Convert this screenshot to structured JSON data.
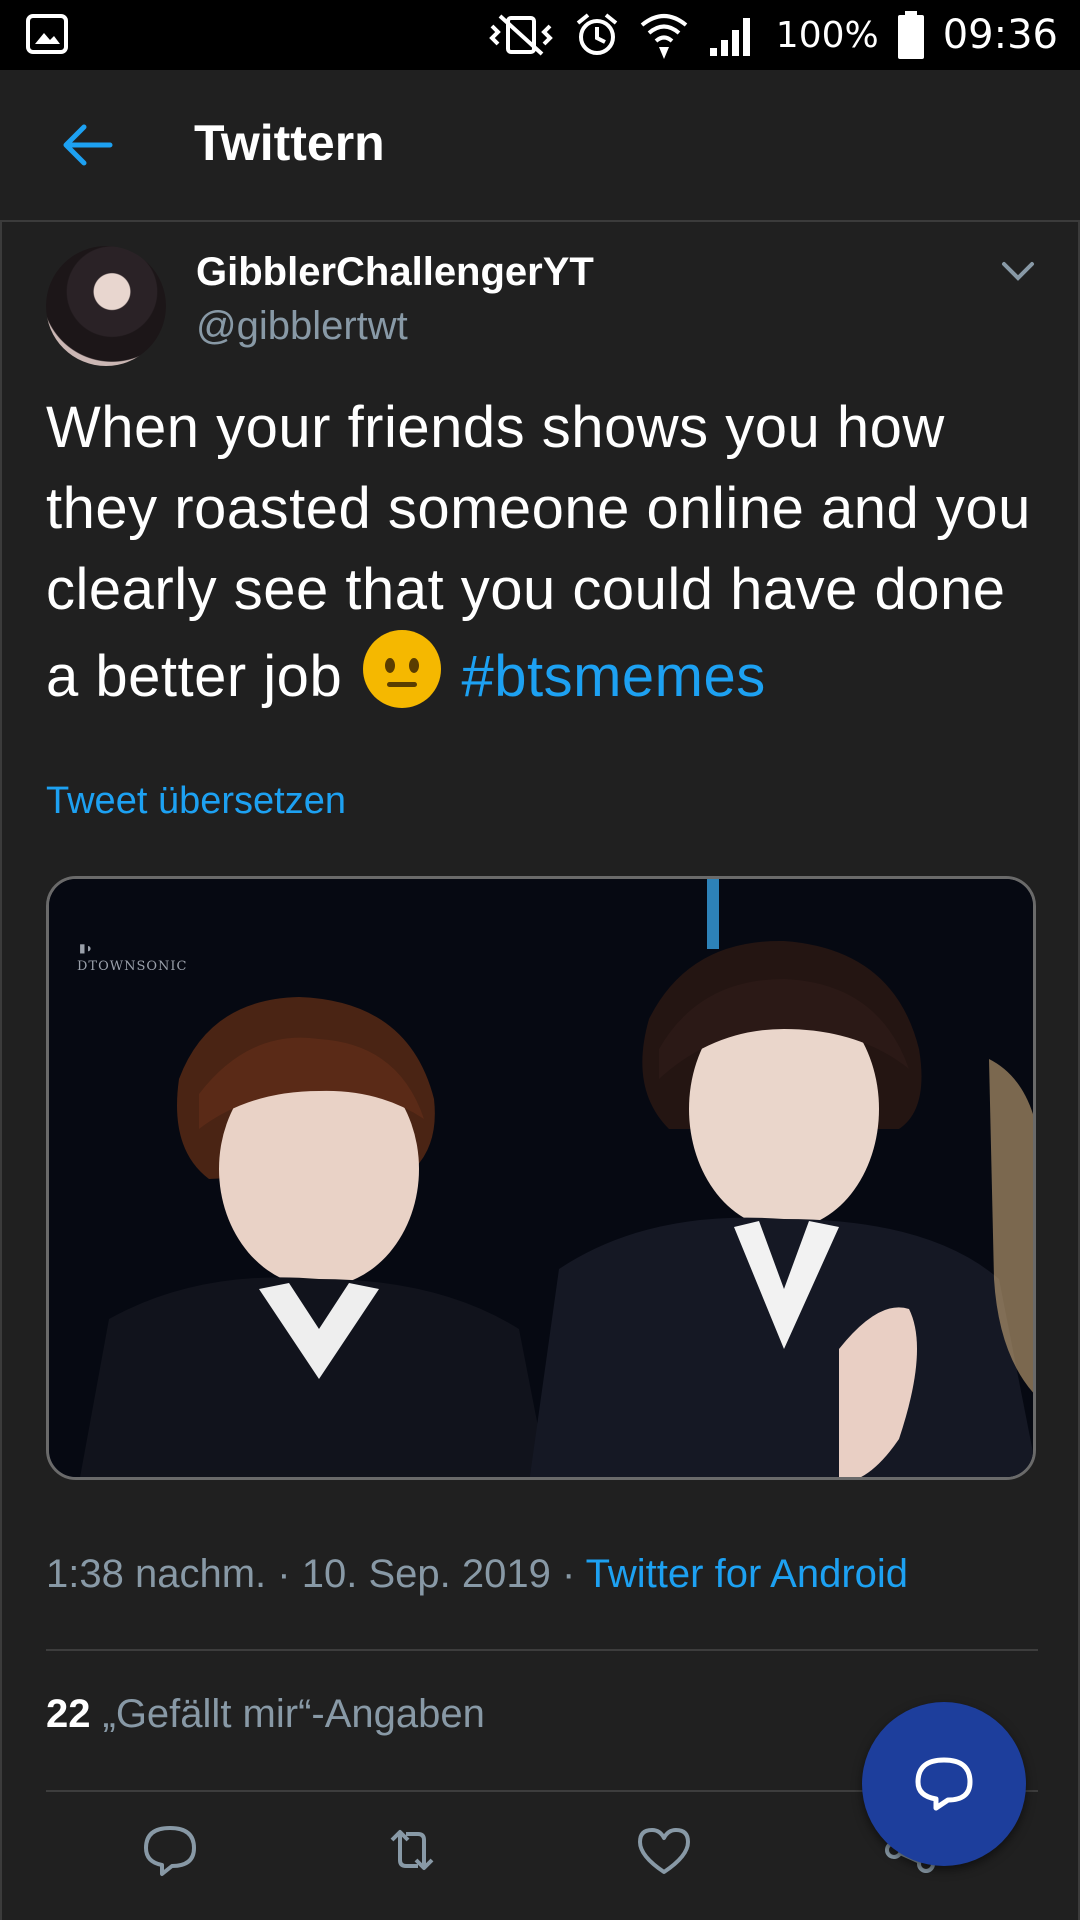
{
  "status_bar": {
    "battery_percent": "100%",
    "time": "09:36",
    "icons": [
      "gallery-icon",
      "mute-vibrate-icon",
      "alarm-icon",
      "wifi-icon",
      "signal-icon",
      "battery-icon"
    ]
  },
  "app_bar": {
    "title": "Twittern",
    "back_icon": "arrow-left-icon"
  },
  "tweet": {
    "display_name": "GibblerChallengerYT",
    "handle": "@gibblertwt",
    "text": "When your friends shows you how they roasted someone online and you clearly see that you could have done a better job",
    "emoji": "neutral-face-emoji",
    "hashtag": "#btsmemes",
    "translate_label": "Tweet übersetzen",
    "media_watermark": "DTOWNSONIC",
    "time": "1:38 nachm.",
    "date": "10. Sep. 2019",
    "separator": "·",
    "client": "Twitter for Android",
    "likes_count": "22",
    "likes_label": "„Gefällt mir“-Angaben"
  },
  "actions": [
    "reply-icon",
    "retweet-icon",
    "like-icon",
    "share-icon"
  ],
  "fab_icon": "reply-icon",
  "colors": {
    "background": "#202020",
    "accent": "#1da1f2",
    "secondary_text": "#8899a6",
    "fab": "#1d3e9c"
  }
}
